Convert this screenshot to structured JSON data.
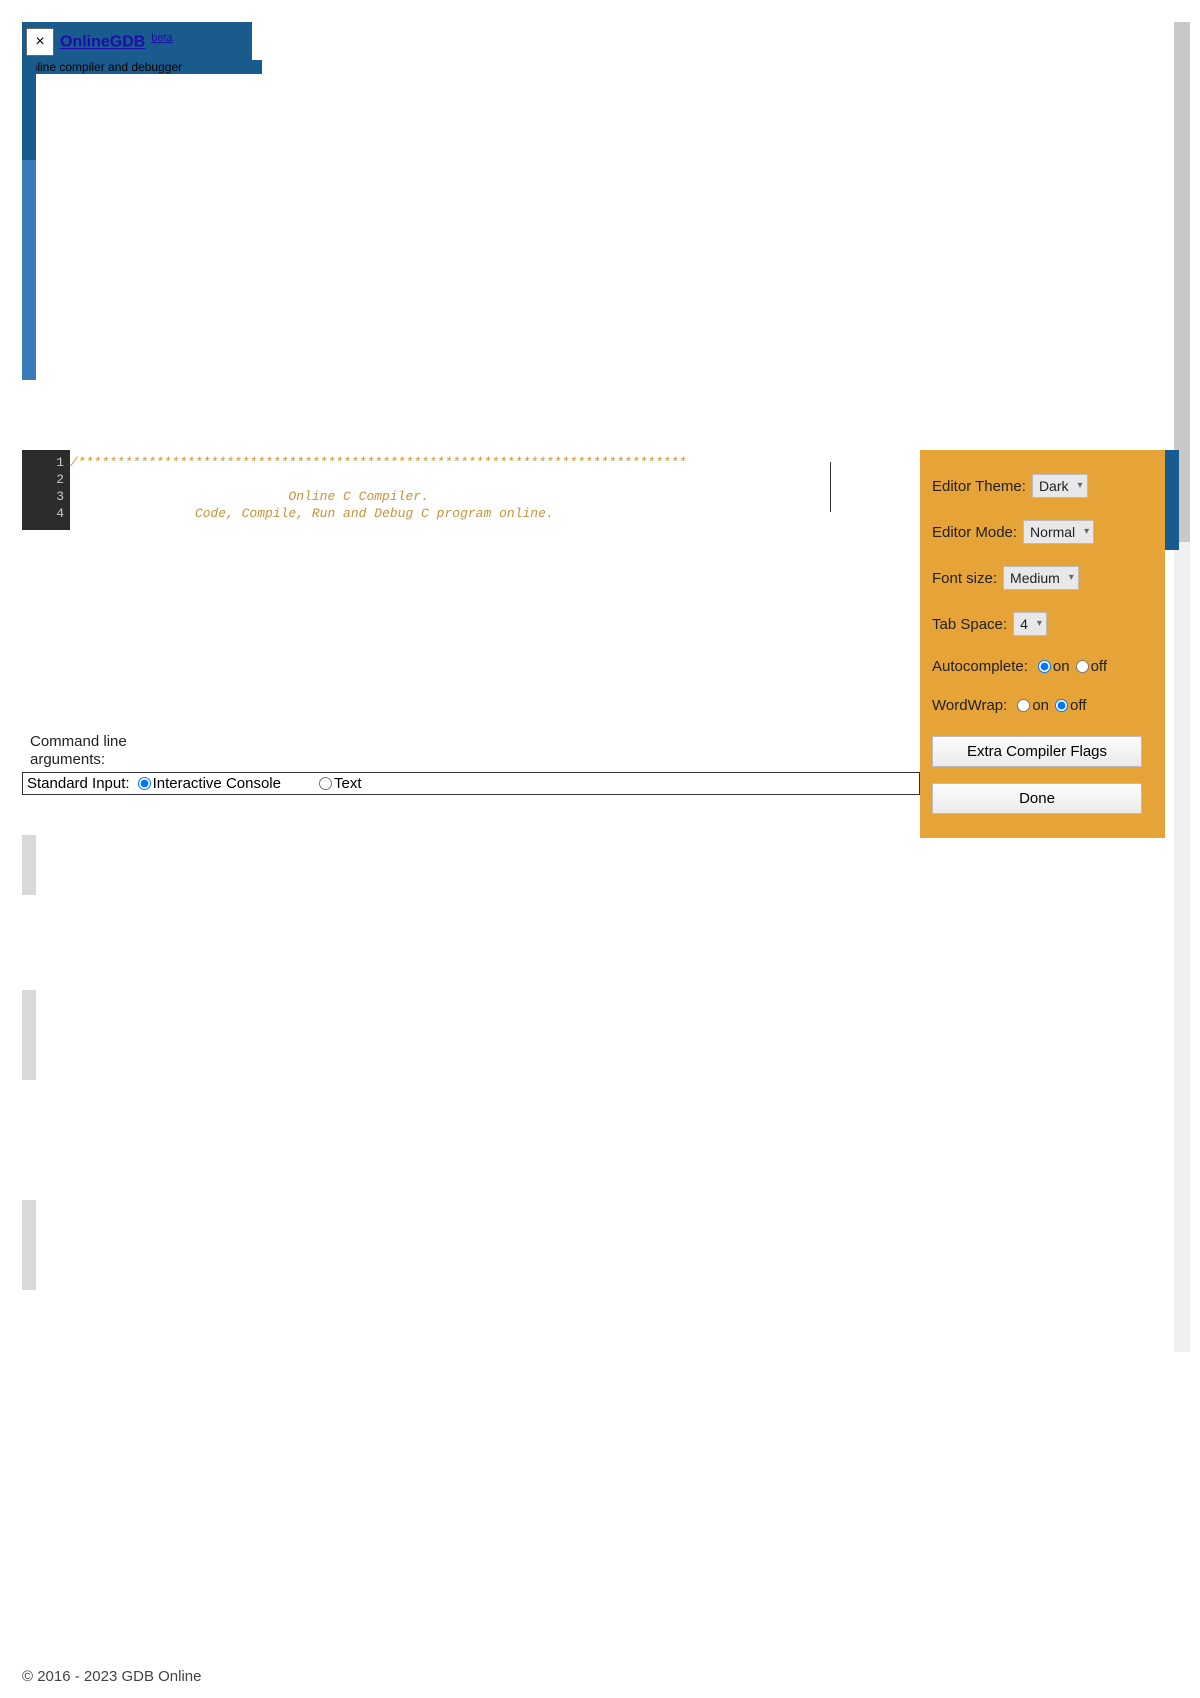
{
  "header": {
    "close_glyph": "×",
    "logo_text": "OnlineGDB",
    "beta_text": "beta",
    "tagline": "online compiler and debugger"
  },
  "editor": {
    "line_numbers": [
      "1",
      "2",
      "3",
      "4"
    ],
    "code_l1": "/******************************************************************************",
    "code_l2": "",
    "code_l3": "                            Online C Compiler.",
    "code_l4": "                Code, Compile, Run and Debug C program online."
  },
  "cmd": {
    "args_label": "Command line arguments:",
    "stdin_label": "Standard Input:",
    "opt_interactive": "Interactive Console",
    "opt_text": "Text"
  },
  "settings": {
    "editor_theme_label": "Editor Theme:",
    "editor_theme_value": "Dark",
    "editor_mode_label": "Editor Mode:",
    "editor_mode_value": "Normal",
    "font_size_label": "Font size:",
    "font_size_value": "Medium",
    "tab_space_label": "Tab Space:",
    "tab_space_value": "4",
    "autocomplete_label": "Autocomplete:",
    "wordwrap_label": "WordWrap:",
    "on_label": "on",
    "off_label": "off",
    "extra_flags_btn": "Extra Compiler Flags",
    "done_btn": "Done"
  },
  "footer": {
    "copyright": "© 2016 - 2023 GDB Online"
  }
}
